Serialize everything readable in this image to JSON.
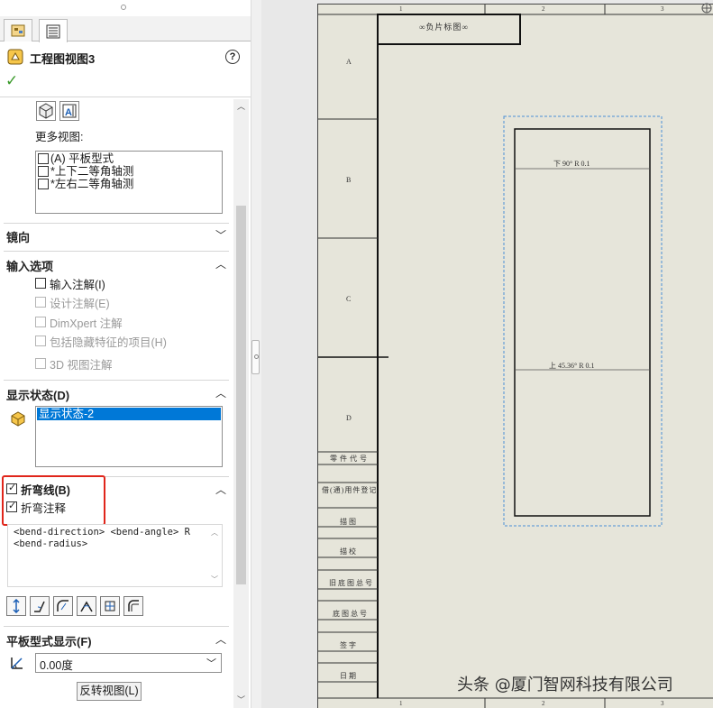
{
  "panel": {
    "title": "工程图视图3",
    "help_label": "?",
    "more_views_label": "更多视图:",
    "more_views": [
      "(A) 平板型式",
      "*上下二等角轴测",
      "*左右二等角轴测"
    ],
    "sections": {
      "mirror": "镜向",
      "import_options": "输入选项",
      "display_state": "显示状态(D)",
      "bend_lines": "折弯线(B)",
      "flat_pattern": "平板型式显示(F)"
    },
    "import_options": [
      {
        "label": "输入注解(I)",
        "checked": false,
        "enabled": true
      },
      {
        "label": "设计注解(E)",
        "checked": false,
        "enabled": false
      },
      {
        "label": "DimXpert 注解",
        "checked": false,
        "enabled": false
      },
      {
        "label": "包括隐藏特征的项目(H)",
        "checked": false,
        "enabled": false
      },
      {
        "label": "3D 视图注解",
        "checked": false,
        "enabled": false
      }
    ],
    "display_state_item": "显示状态-2",
    "bend_options": [
      {
        "label": "折弯线(B)",
        "checked": true
      },
      {
        "label": "折弯注释",
        "checked": true
      }
    ],
    "bend_note_line1": "<bend-direction> <bend-angle> R",
    "bend_note_line2": "<bend-radius>",
    "angle_value": "0.00度",
    "flip_view_label": "反转视图(L)"
  },
  "sheet": {
    "title_block_top": "∞负片标图∞",
    "col_numbers": [
      "1",
      "2",
      "3"
    ],
    "row_letters": [
      "A",
      "B",
      "C",
      "D"
    ],
    "bend_note_down": "下 90°  R 0.1",
    "bend_note_up": "上 45.36°  R 0.1",
    "side_table": [
      "零件代号",
      "借(通)用件登记",
      "描图",
      "描校",
      "旧底图总号",
      "底图总号",
      "签字",
      "日期"
    ]
  },
  "watermark": "头条 @厦门智网科技有限公司",
  "colors": {
    "accent_select": "#0078d7",
    "highlight_red": "#e0261b",
    "ok_green": "#3a9a2a",
    "sheet_bg": "#e6e5da",
    "dash_blue": "#4a8fd6"
  }
}
